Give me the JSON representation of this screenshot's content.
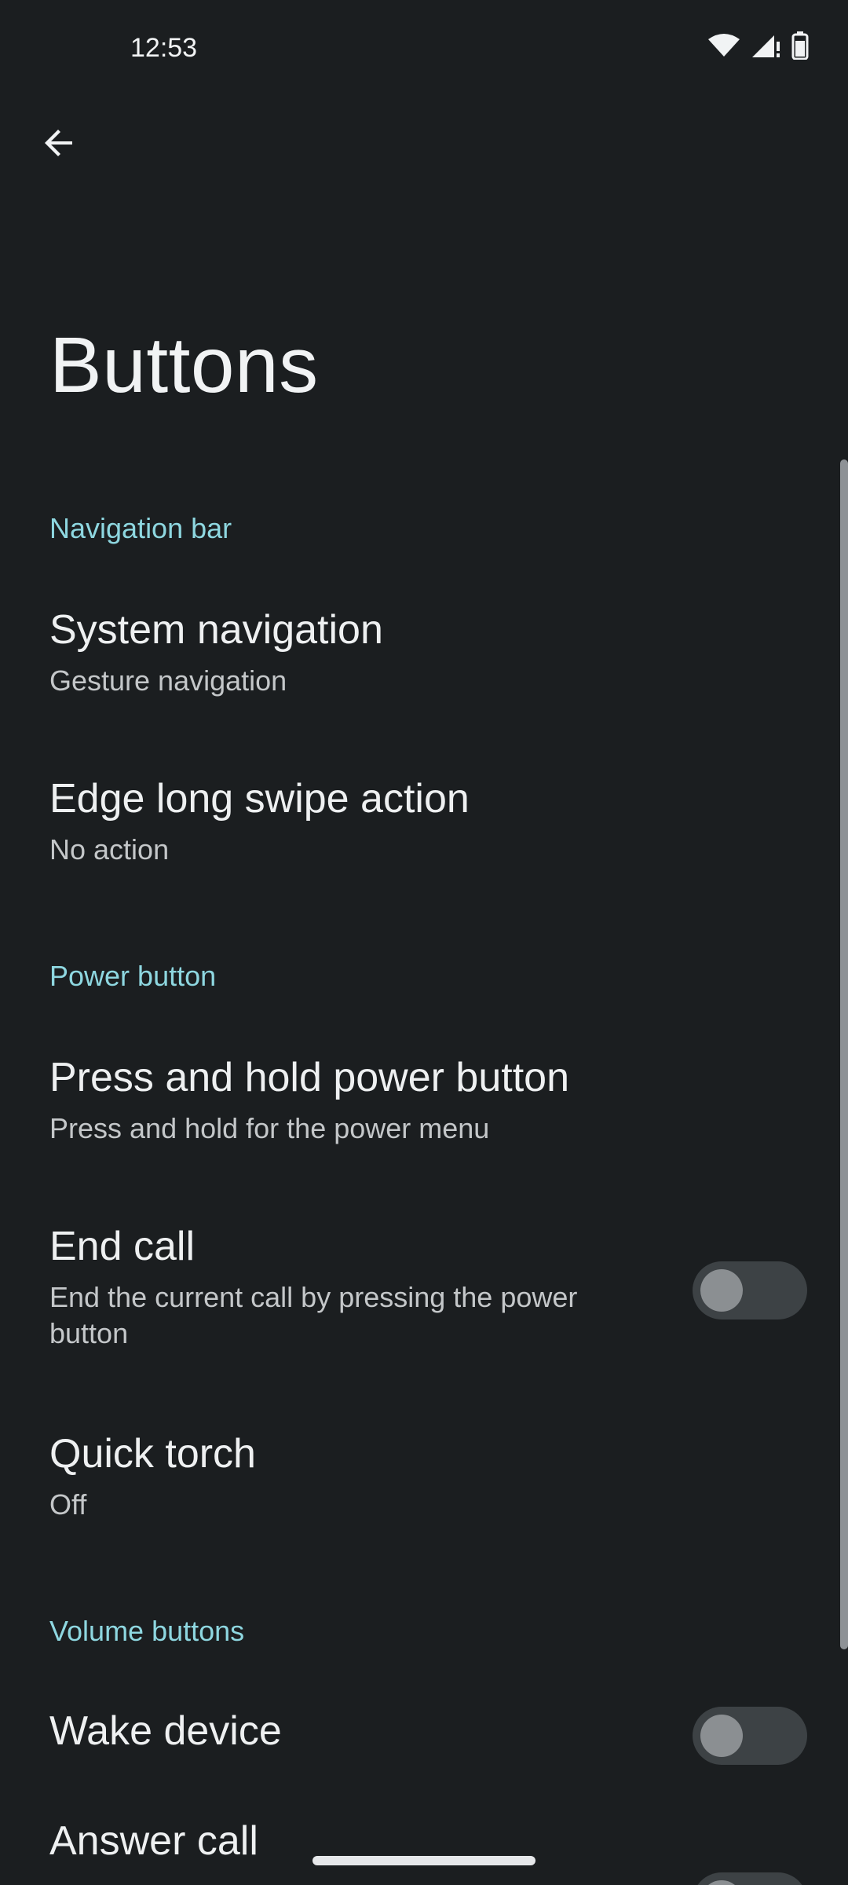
{
  "status_bar": {
    "time": "12:53",
    "icons": [
      "wifi-icon",
      "signal-icon",
      "battery-icon"
    ]
  },
  "header": {
    "back_icon": "arrow-back-icon",
    "title": "Buttons"
  },
  "sections": {
    "navigation_bar": {
      "label": "Navigation bar",
      "system_navigation": {
        "title": "System navigation",
        "summary": "Gesture navigation"
      },
      "edge_swipe": {
        "title": "Edge long swipe action",
        "summary": "No action"
      }
    },
    "power_button": {
      "label": "Power button",
      "press_hold": {
        "title": "Press and hold power button",
        "summary": "Press and hold for the power menu"
      },
      "end_call": {
        "title": "End call",
        "summary": "End the current call by pressing the power button",
        "enabled": false
      },
      "quick_torch": {
        "title": "Quick torch",
        "summary": "Off"
      }
    },
    "volume_buttons": {
      "label": "Volume buttons",
      "wake_device": {
        "title": "Wake device",
        "enabled": false
      },
      "answer_call": {
        "title": "Answer call",
        "enabled": false
      }
    }
  },
  "colors": {
    "background": "#1b1e20",
    "accent": "#8ed7e0",
    "toggle_off_track": "#3d4245",
    "toggle_off_knob": "#8b8f92"
  }
}
